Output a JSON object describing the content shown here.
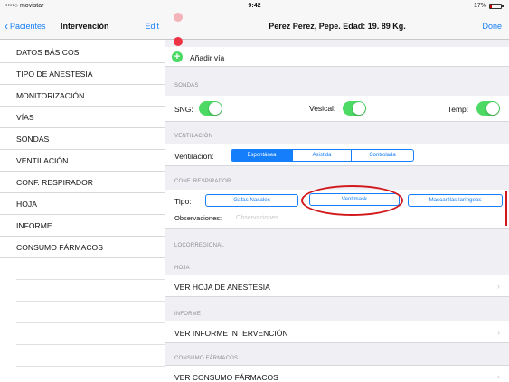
{
  "status_bar": {
    "carrier": "••••○ movistar",
    "wifi": "wifi-icon",
    "time": "9:42",
    "battery": "17%"
  },
  "left_nav": {
    "back_label": "Pacientes",
    "title": "Intervención",
    "edit_label": "Edit"
  },
  "menu_items": [
    "DATOS BÁSICOS",
    "TIPO DE ANESTESIA",
    "MONITORIZACIÓN",
    "VÍAS",
    "SONDAS",
    "VENTILACIÓN",
    "CONF. RESPIRADOR",
    "HOJA",
    "INFORME",
    "CONSUMO FÁRMACOS"
  ],
  "right_nav": {
    "title": "Perez Perez, Pepe. Edad: 19. 89 Kg.",
    "done_label": "Done"
  },
  "vias": {
    "add_label": "Añadir vía"
  },
  "sondas": {
    "header": "SONDAS",
    "sng_label": "SNG:",
    "vesical_label": "Vesical:",
    "temp_label": "Temp:",
    "sng_on": true,
    "vesical_on": true,
    "temp_on": true
  },
  "ventilacion": {
    "header": "VENTILACIÓN",
    "label": "Ventilación:",
    "options": [
      "Espontánea",
      "Asistida",
      "Controlada"
    ],
    "selected": "Espontánea"
  },
  "respirador": {
    "header": "CONF. RESPIRADOR",
    "tipo_label": "Tipo:",
    "options": [
      "Gafas Nasales",
      "Ventimask",
      "Mascarillas laríngeas"
    ],
    "obs_label": "Observaciones:",
    "obs_placeholder": "Observaciones"
  },
  "locorregional": {
    "header": "LOCORREGIONAL"
  },
  "hoja": {
    "header": "HOJA",
    "link": "VER HOJA DE ANESTESIA"
  },
  "informe": {
    "header": "INFORME",
    "link": "VER INFORME INTERVENCIÓN"
  },
  "consumo": {
    "header": "CONSUMO FÁRMACOS",
    "link": "VER CONSUMO FÁRMACOS"
  },
  "colors": {
    "accent": "#147efb",
    "toggle_on": "#4cd964",
    "annotation": "#d2181c",
    "delete_red": "#e34444"
  }
}
